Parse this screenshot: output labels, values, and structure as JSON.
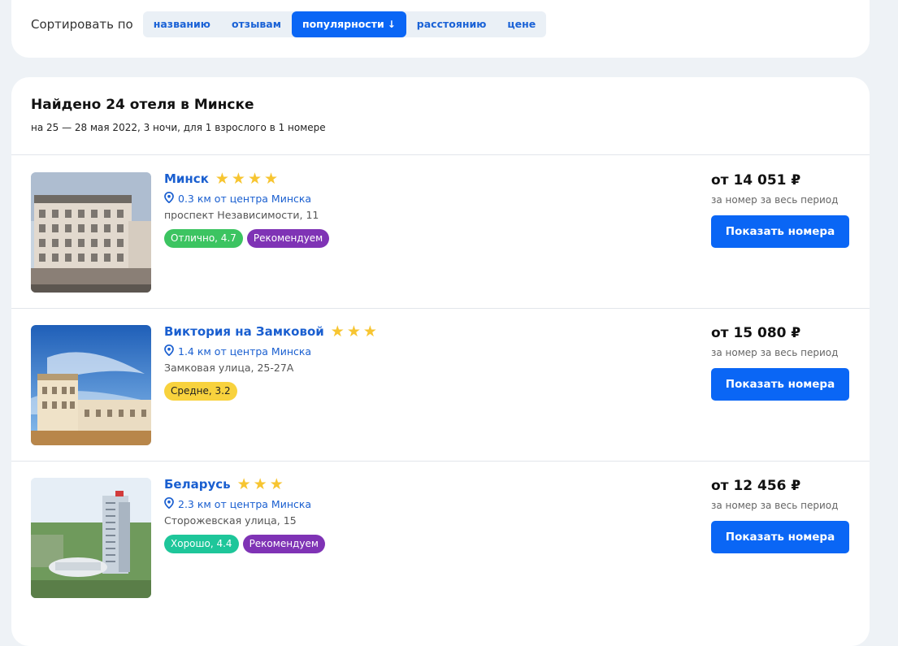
{
  "sort": {
    "label": "Сортировать по",
    "options": [
      {
        "label": "названию",
        "active": false
      },
      {
        "label": "отзывам",
        "active": false
      },
      {
        "label": "популярности",
        "active": true,
        "arrow": "↓"
      },
      {
        "label": "расстоянию",
        "active": false
      },
      {
        "label": "цене",
        "active": false
      }
    ]
  },
  "results": {
    "title": "Найдено 24 отеля в Минске",
    "subtitle": "на 25 — 28 мая 2022, 3 ночи, для 1 взрослого в 1 номере"
  },
  "colors": {
    "accent": "#0a66f5",
    "link": "#1a5fd0",
    "star": "#f7c531",
    "badge_excellent": "#3cc461",
    "badge_recommend": "#7f33b5",
    "badge_average": "#f8d23d",
    "badge_good": "#1ec69a"
  },
  "hotels": [
    {
      "name": "Минск",
      "stars": 4,
      "distance": "0.3 км от центра Минска",
      "address": "проспект Независимости, 11",
      "badges": [
        {
          "text": "Отлично, 4.7",
          "color": "#3cc461",
          "text_color": "#ffffff"
        },
        {
          "text": "Рекомендуем",
          "color": "#7f33b5",
          "text_color": "#ffffff"
        }
      ],
      "price": "от 14 051 ₽",
      "price_note": "за номер за весь период",
      "button": "Показать номера"
    },
    {
      "name": "Виктория на Замковой",
      "stars": 3,
      "distance": "1.4 км от центра Минска",
      "address": "Замковая улица, 25-27А",
      "badges": [
        {
          "text": "Средне, 3.2",
          "color": "#f8d23d",
          "text_color": "#222222"
        }
      ],
      "price": "от 15 080 ₽",
      "price_note": "за номер за весь период",
      "button": "Показать номера"
    },
    {
      "name": "Беларусь",
      "stars": 3,
      "distance": "2.3 км от центра Минска",
      "address": "Сторожевская улица, 15",
      "badges": [
        {
          "text": "Хорошо, 4.4",
          "color": "#1ec69a",
          "text_color": "#ffffff"
        },
        {
          "text": "Рекомендуем",
          "color": "#7f33b5",
          "text_color": "#ffffff"
        }
      ],
      "price": "от 12 456 ₽",
      "price_note": "за номер за весь период",
      "button": "Показать номера"
    }
  ]
}
